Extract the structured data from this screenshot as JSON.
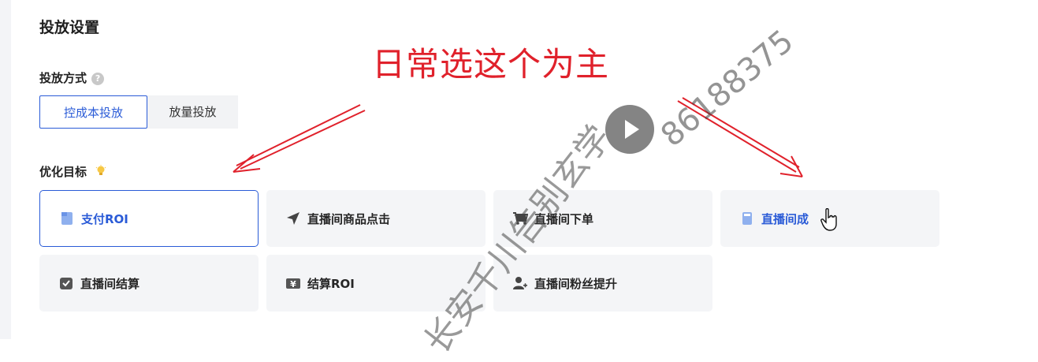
{
  "section_title": "投放设置",
  "delivery_method": {
    "label": "投放方式",
    "help_icon": "?",
    "options": [
      "控成本投放",
      "放量投放"
    ],
    "selected": "控成本投放"
  },
  "optimization_goal": {
    "label": "优化目标",
    "options": [
      {
        "label": "支付ROI",
        "icon": "document-icon"
      },
      {
        "label": "直播间商品点击",
        "icon": "pointer-arrow-icon"
      },
      {
        "label": "直播间下单",
        "icon": "cart-icon"
      },
      {
        "label": "直播间成",
        "icon": "document-icon"
      },
      {
        "label": "直播间结算",
        "icon": "check-box-icon"
      },
      {
        "label": "结算ROI",
        "icon": "yen-icon"
      },
      {
        "label": "直播间粉丝提升",
        "icon": "user-plus-icon"
      }
    ],
    "selected": "支付ROI"
  },
  "annotation": "日常选这个为主",
  "watermark": "长安千川告别玄学",
  "watermark_number": "86188375",
  "colors": {
    "accent": "#2a5bd7",
    "annotation": "#e0212b",
    "card_bg": "#f4f5f7"
  }
}
